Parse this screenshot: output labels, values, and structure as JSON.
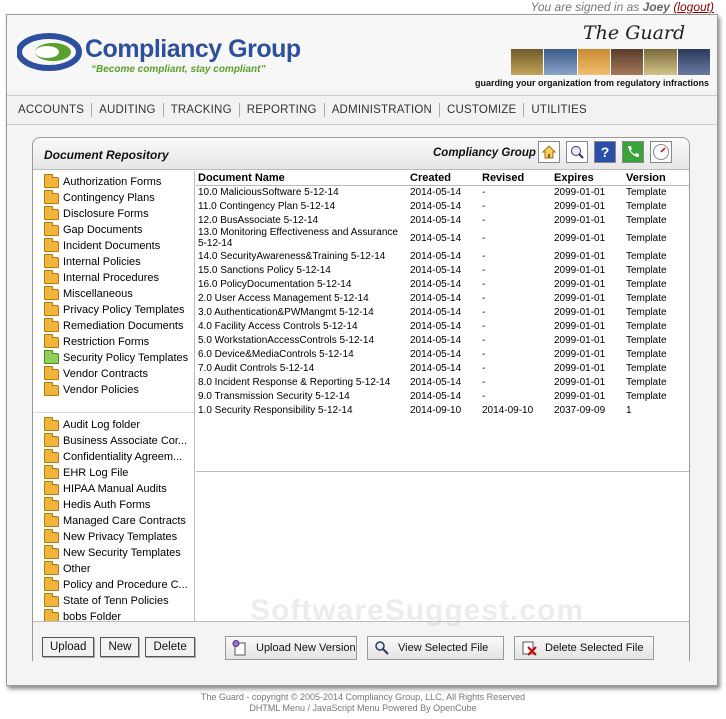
{
  "session": {
    "prefix": "You are signed in as",
    "user": "Joey",
    "logout": "(logout)"
  },
  "brand": {
    "name": "Compliancy Group",
    "slogan": "“Become compliant, stay compliant”",
    "product": "The Guard",
    "tagline": "guarding your organization from regulatory infractions"
  },
  "menu": [
    "ACCOUNTS",
    "AUDITING",
    "TRACKING",
    "REPORTING",
    "ADMINISTRATION",
    "CUSTOMIZE",
    "UTILITIES"
  ],
  "panel": {
    "title": "Document Repository",
    "company": "Compliancy Group",
    "icons": [
      "home-icon",
      "search-icon",
      "help-icon",
      "phone-icon",
      "gauge-icon"
    ]
  },
  "tree": {
    "group1": [
      "Authorization Forms",
      "Contingency Plans",
      "Disclosure Forms",
      "Gap Documents",
      "Incident Documents",
      "Internal Policies",
      "Internal Procedures",
      "Miscellaneous",
      "Privacy Policy Templates",
      "Remediation Documents",
      "Restriction Forms",
      "Security Policy Templates",
      "Vendor Contracts",
      "Vendor Policies"
    ],
    "selected": "Security Policy Templates",
    "group2": [
      "Audit Log folder",
      "Business Associate Cor...",
      "Confidentiality Agreem...",
      "EHR Log File",
      "HIPAA Manual Audits",
      "Hedis Auth Forms",
      "Managed Care Contracts",
      "New Privacy Templates",
      "New Security Templates",
      "Other",
      "Policy and Procedure C...",
      "State of Tenn Policies",
      "bobs Folder"
    ]
  },
  "table": {
    "columns": [
      "Document Name",
      "Created",
      "Revised",
      "Expires",
      "Version"
    ],
    "rows": [
      [
        "10.0 MaliciousSoftware 5-12-14",
        "2014-05-14",
        "-",
        "2099-01-01",
        "Template"
      ],
      [
        "11.0 Contingency Plan 5-12-14",
        "2014-05-14",
        "-",
        "2099-01-01",
        "Template"
      ],
      [
        "12.0 BusAssociate 5-12-14",
        "2014-05-14",
        "-",
        "2099-01-01",
        "Template"
      ],
      [
        "13.0 Monitoring Effectiveness and Assurance 5-12-14",
        "2014-05-14",
        "-",
        "2099-01-01",
        "Template"
      ],
      [
        "14.0 SecurityAwareness&Training 5-12-14",
        "2014-05-14",
        "-",
        "2099-01-01",
        "Template"
      ],
      [
        "15.0 Sanctions Policy 5-12-14",
        "2014-05-14",
        "-",
        "2099-01-01",
        "Template"
      ],
      [
        "16.0 PolicyDocumentation 5-12-14",
        "2014-05-14",
        "-",
        "2099-01-01",
        "Template"
      ],
      [
        "2.0 User Access Management 5-12-14",
        "2014-05-14",
        "-",
        "2099-01-01",
        "Template"
      ],
      [
        "3.0 Authentication&PWMangmt 5-12-14",
        "2014-05-14",
        "-",
        "2099-01-01",
        "Template"
      ],
      [
        "4.0 Facility Access Controls 5-12-14",
        "2014-05-14",
        "-",
        "2099-01-01",
        "Template"
      ],
      [
        "5.0 WorkstationAccessControls 5-12-14",
        "2014-05-14",
        "-",
        "2099-01-01",
        "Template"
      ],
      [
        "6.0 Device&MediaControls 5-12-14",
        "2014-05-14",
        "-",
        "2099-01-01",
        "Template"
      ],
      [
        "7.0 Audit Controls 5-12-14",
        "2014-05-14",
        "-",
        "2099-01-01",
        "Template"
      ],
      [
        "8.0 Incident Response & Reporting 5-12-14",
        "2014-05-14",
        "-",
        "2099-01-01",
        "Template"
      ],
      [
        "9.0 Transmission Security 5-12-14",
        "2014-05-14",
        "-",
        "2099-01-01",
        "Template"
      ],
      [
        "1.0 Security Responsibility 5-12-14",
        "2014-09-10",
        "2014-09-10",
        "2037-09-09",
        "1"
      ]
    ]
  },
  "buttons": {
    "upload": "Upload",
    "new": "New",
    "delete": "Delete",
    "upload_version": "Upload New Version",
    "view_file": "View Selected File",
    "delete_file": "Delete Selected File"
  },
  "footer": {
    "line1": "The Guard - copyright © 2005-2014 Compliancy Group, LLC, All Rights Reserved",
    "line2": "DHTML Menu / JavaScript Menu Powered By OpenCube"
  },
  "watermark": "SoftwareSuggest.com",
  "colors": {
    "brand_blue": "#2c4f9e",
    "brand_green": "#5aa02c",
    "folder": "#f0b43a",
    "folder_selected": "#8fcf5a",
    "logout": "#8b0000"
  }
}
